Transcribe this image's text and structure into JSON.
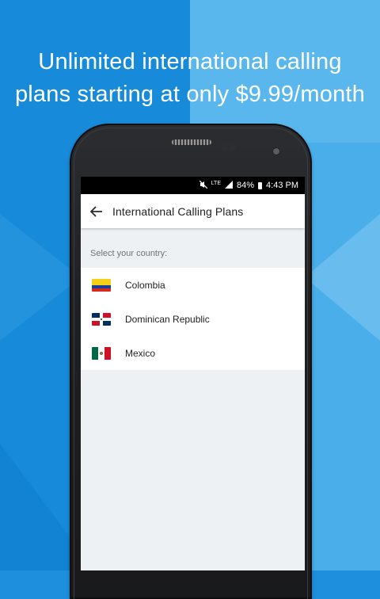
{
  "promo": {
    "headline_line1": "Unlimited international calling",
    "headline_line2": "plans starting at only $9.99/month"
  },
  "status_bar": {
    "network": "LTE",
    "battery": "84%",
    "time": "4:43 PM"
  },
  "app_bar": {
    "back_icon": "arrow-left-icon",
    "title": "International Calling Plans"
  },
  "country_list": {
    "prompt": "Select your country:",
    "items": [
      {
        "name": "Colombia",
        "flag_icon": "colombia-flag-icon"
      },
      {
        "name": "Dominican Republic",
        "flag_icon": "dominican-republic-flag-icon"
      },
      {
        "name": "Mexico",
        "flag_icon": "mexico-flag-icon"
      }
    ]
  },
  "colors": {
    "background_blue": "#1d8fdc",
    "background_light_blue": "#4aaeea",
    "screen_background": "#eef1f4",
    "status_bar": "#000000"
  }
}
